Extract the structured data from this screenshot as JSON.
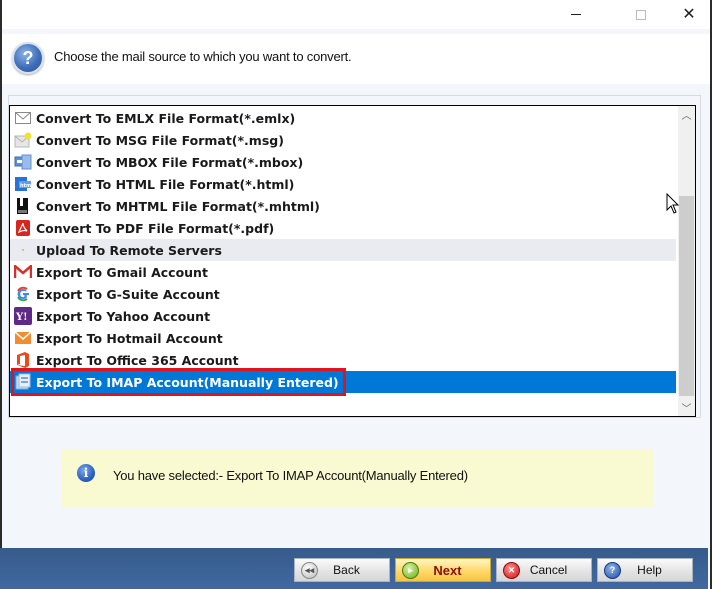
{
  "window": {
    "controls": {
      "minimize": "minimize",
      "maximize": "maximize",
      "close": "close"
    }
  },
  "header": {
    "instruction": "Choose the mail source to which you want to convert."
  },
  "list": {
    "items": [
      {
        "label": "Convert To EMLX File Format(*.emlx)",
        "icon": "envelope-icon",
        "type": "item",
        "selected": false
      },
      {
        "label": "Convert To MSG File Format(*.msg)",
        "icon": "msg-file-icon",
        "type": "item",
        "selected": false
      },
      {
        "label": "Convert To MBOX File Format(*.mbox)",
        "icon": "mbox-file-icon",
        "type": "item",
        "selected": false
      },
      {
        "label": "Convert To HTML File Format(*.html)",
        "icon": "html-file-icon",
        "type": "item",
        "selected": false
      },
      {
        "label": "Convert To MHTML File Format(*.mhtml)",
        "icon": "mhtml-file-icon",
        "type": "item",
        "selected": false
      },
      {
        "label": "Convert To PDF File Format(*.pdf)",
        "icon": "pdf-file-icon",
        "type": "item",
        "selected": false
      },
      {
        "label": "Upload To Remote Servers",
        "icon": "",
        "type": "group",
        "selected": false
      },
      {
        "label": "Export To Gmail Account",
        "icon": "gmail-icon",
        "type": "item",
        "selected": false
      },
      {
        "label": "Export To G-Suite Account",
        "icon": "google-icon",
        "type": "item",
        "selected": false
      },
      {
        "label": "Export To Yahoo Account",
        "icon": "yahoo-icon",
        "type": "item",
        "selected": false
      },
      {
        "label": "Export To Hotmail Account",
        "icon": "hotmail-icon",
        "type": "item",
        "selected": false
      },
      {
        "label": "Export To Office 365 Account",
        "icon": "office365-icon",
        "type": "item",
        "selected": false
      },
      {
        "label": "Export To IMAP Account(Manually Entered)",
        "icon": "imap-server-icon",
        "type": "item",
        "selected": true
      }
    ],
    "selection_color": "#0078d7",
    "highlight_color": "#e0141e"
  },
  "info": {
    "message": "You have selected:- Export To IMAP Account(Manually Entered)"
  },
  "footer": {
    "back_label": "Back",
    "next_label": "Next",
    "cancel_label": "Cancel",
    "help_label": "Help"
  }
}
